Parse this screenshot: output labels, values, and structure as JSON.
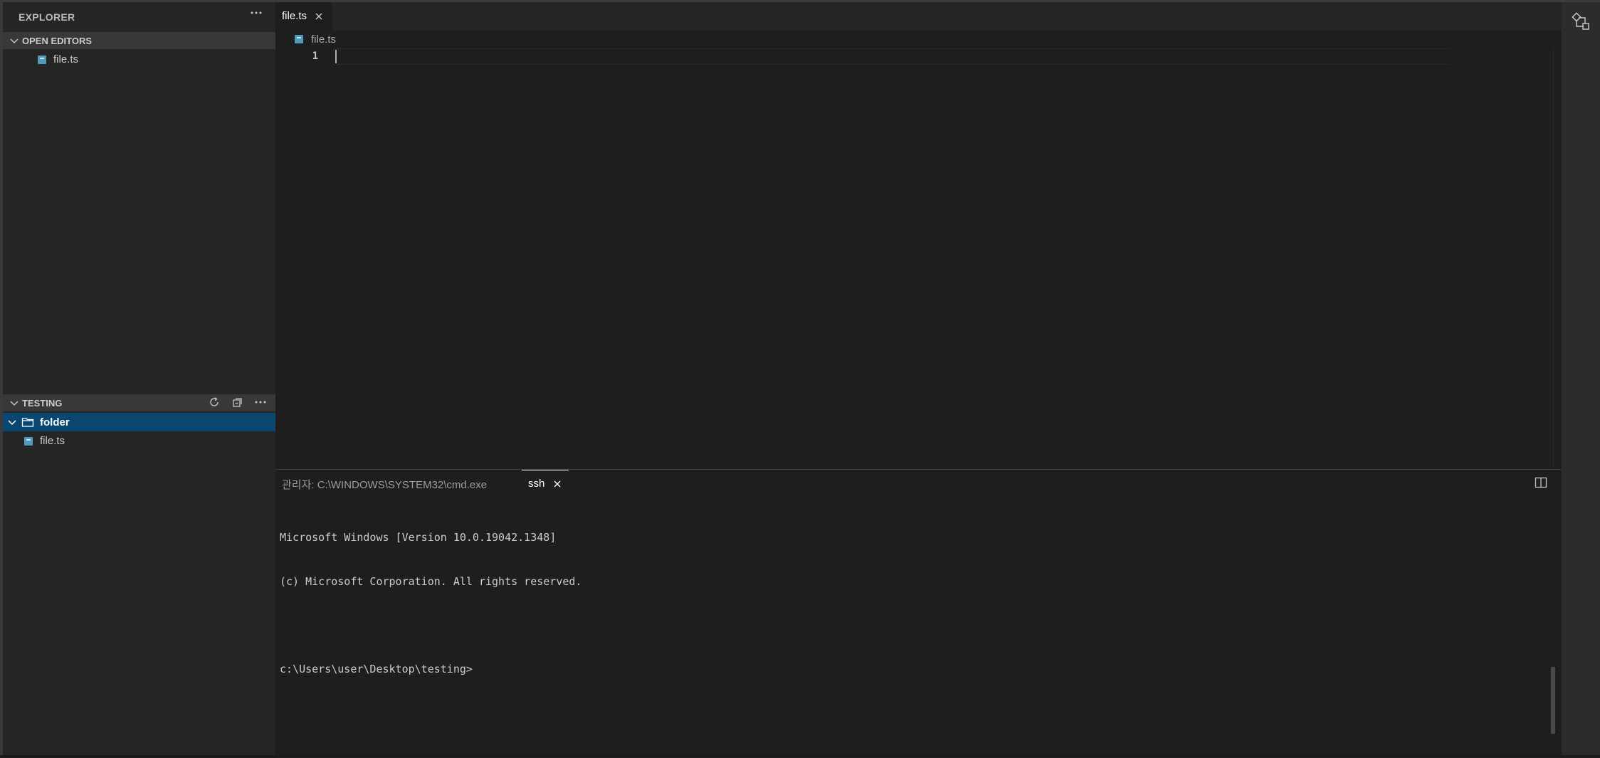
{
  "sidebar": {
    "title": "EXPLORER",
    "more_icon": "ellipsis-icon",
    "open_editors": {
      "title": "OPEN EDITORS",
      "items": [
        {
          "label": "file.ts",
          "icon": "typescript-file-icon"
        }
      ]
    },
    "testing": {
      "title": "TESTING",
      "actions": [
        "refresh-icon",
        "collapse-all-icon",
        "ellipsis-icon"
      ],
      "tree": [
        {
          "label": "folder",
          "icon": "folder-icon",
          "expanded": true,
          "selected": true
        },
        {
          "label": "file.ts",
          "icon": "typescript-file-icon"
        }
      ]
    }
  },
  "editor": {
    "tab": {
      "label": "file.ts"
    },
    "breadcrumb": {
      "label": "file.ts"
    },
    "line_numbers": [
      "1"
    ]
  },
  "panel": {
    "tabs": [
      {
        "label": "관리자: C:\\WINDOWS\\SYSTEM32\\cmd.exe",
        "active": false
      },
      {
        "label": "ssh",
        "active": true
      }
    ],
    "terminal": {
      "lines": [
        "Microsoft Windows [Version 10.0.19042.1348]",
        "(c) Microsoft Corporation. All rights reserved.",
        "",
        "c:\\Users\\user\\Desktop\\testing>"
      ]
    }
  },
  "colors": {
    "selection": "#094771",
    "sidebar_bg": "#252526",
    "editor_bg": "#1e1e1e",
    "ts_icon": "#519aba"
  }
}
